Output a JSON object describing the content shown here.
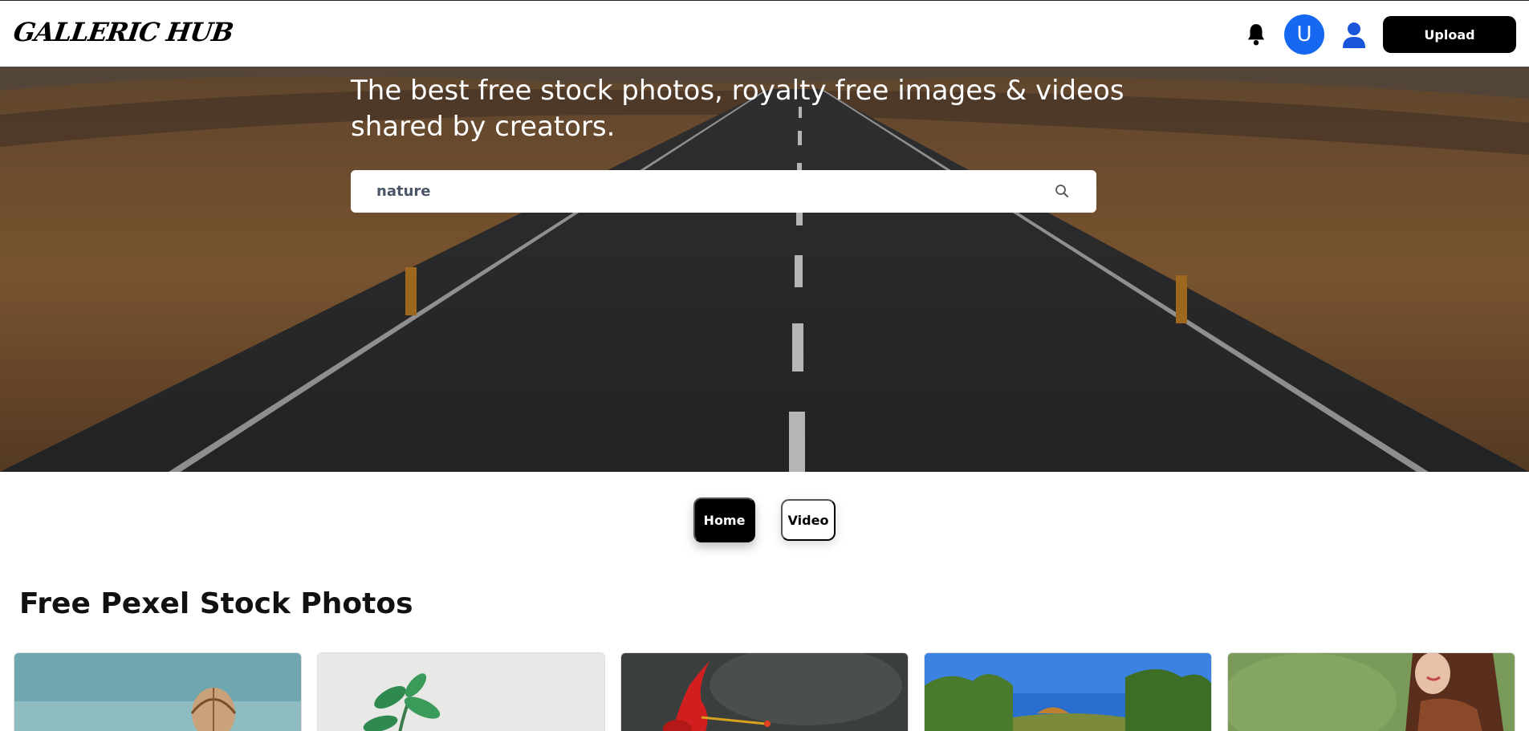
{
  "header": {
    "logo": "GALLERIC HUB",
    "avatar_letter": "U",
    "upload_label": "Upload",
    "icons": [
      "bell-icon",
      "user-icon"
    ]
  },
  "hero": {
    "title": "The best free stock photos, royalty free images & videos shared by creators.",
    "search": {
      "value": "nature"
    }
  },
  "tabs": [
    {
      "label": "Home",
      "active": true
    },
    {
      "label": "Video",
      "active": false
    }
  ],
  "section": {
    "title": "Free Pexel Stock Photos"
  },
  "gallery": {
    "cards": [
      {
        "alt": "hot-air-balloon"
      },
      {
        "alt": "green-plant"
      },
      {
        "alt": "red-hibiscus"
      },
      {
        "alt": "lake-trees"
      },
      {
        "alt": "woman-portrait"
      }
    ]
  },
  "colors": {
    "accent_blue": "#1668f0",
    "dark": "#000000"
  }
}
